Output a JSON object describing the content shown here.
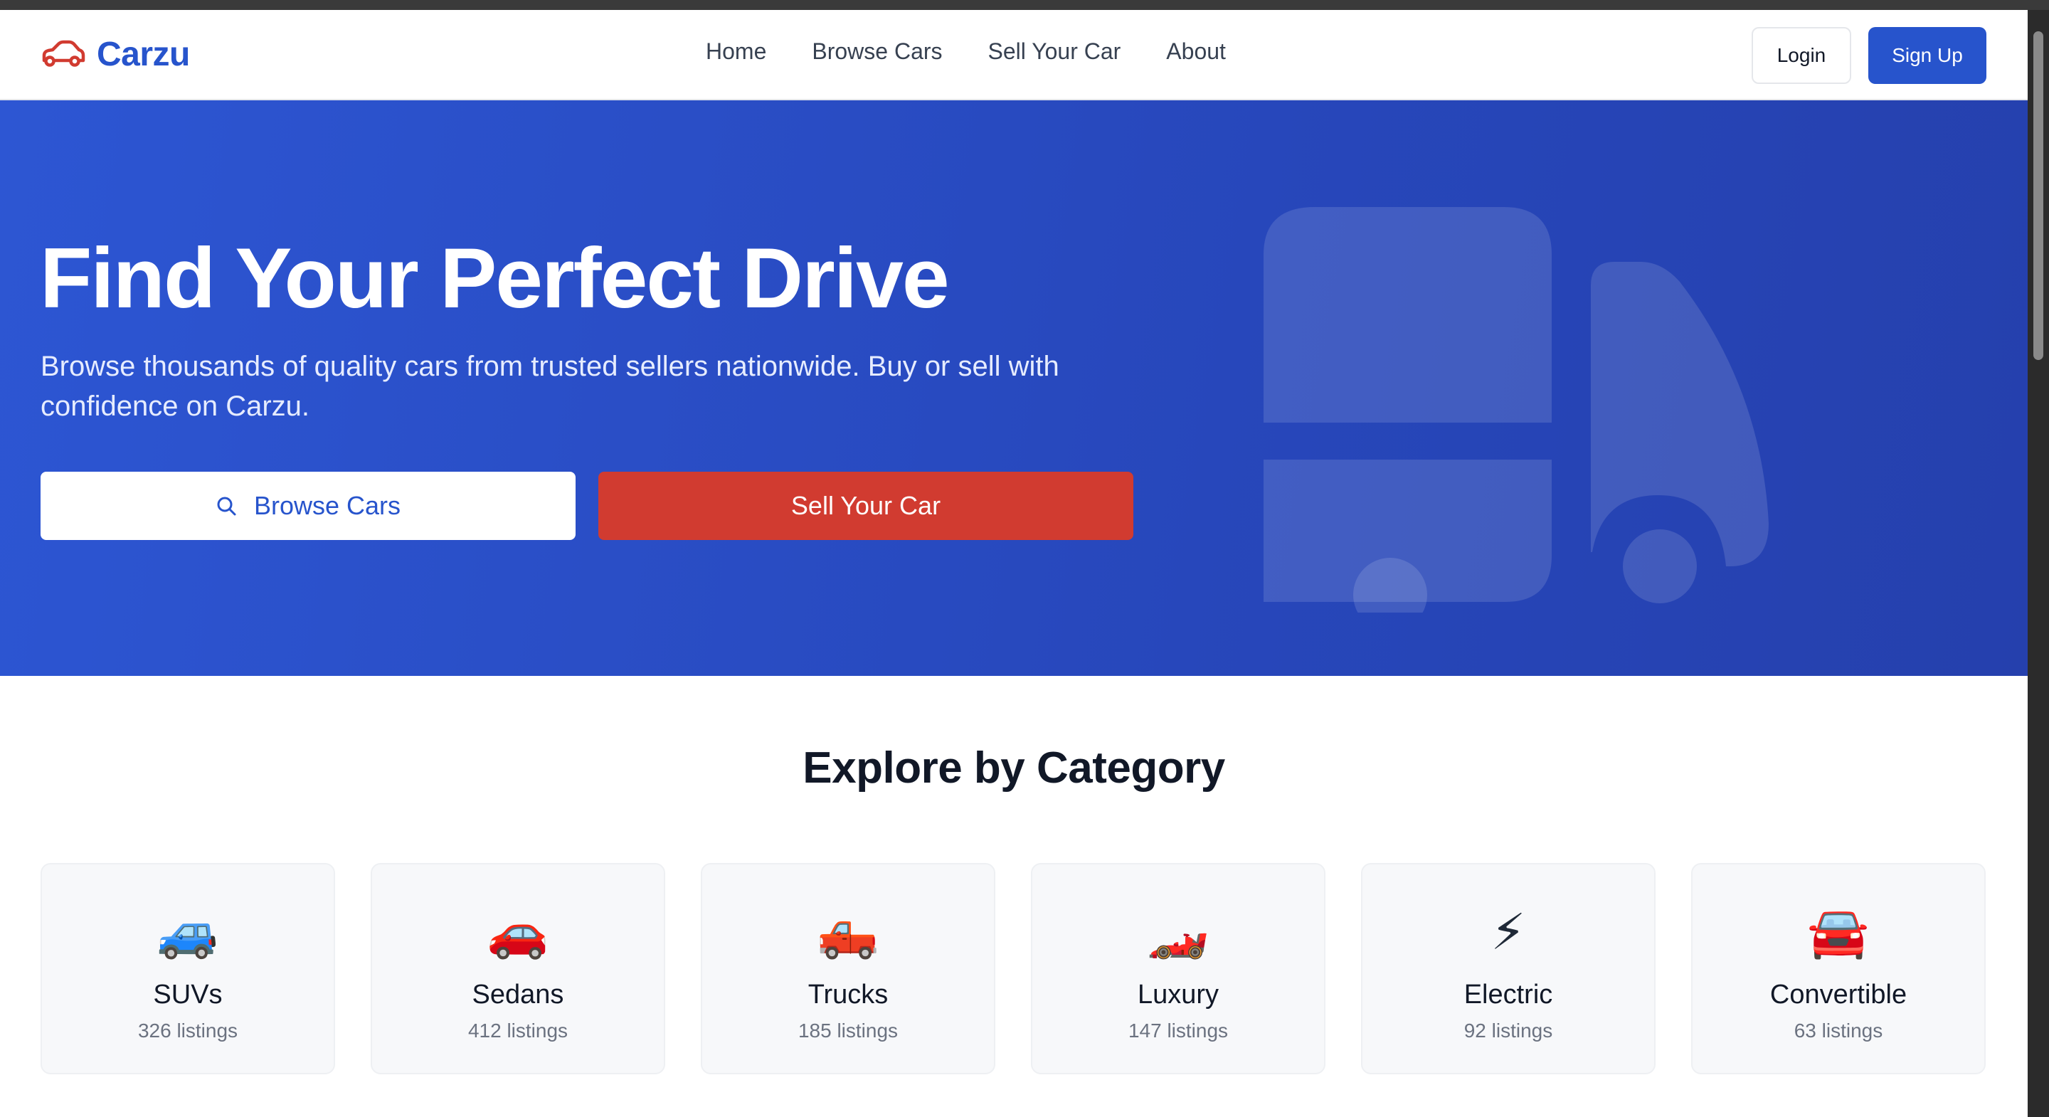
{
  "brand": {
    "name": "Carzu",
    "icon": "car-icon",
    "color": "#2754cc",
    "icon_color": "#d13b30"
  },
  "nav": {
    "links": [
      {
        "label": "Home"
      },
      {
        "label": "Browse Cars"
      },
      {
        "label": "Sell Your Car"
      },
      {
        "label": "About"
      }
    ],
    "login_label": "Login",
    "signup_label": "Sign Up"
  },
  "hero": {
    "title": "Find Your Perfect Drive",
    "subtitle": "Browse thousands of quality cars from trusted sellers nationwide. Buy or sell with confidence on Carzu.",
    "browse_label": "Browse Cars",
    "browse_icon": "search-icon",
    "sell_label": "Sell Your Car",
    "background_art": "truck-icon",
    "colors": {
      "background": "#2d56d3",
      "sell_button": "#d13b30"
    }
  },
  "categories": {
    "title": "Explore by Category",
    "items": [
      {
        "name": "SUVs",
        "count": "326 listings",
        "icon": "🚙"
      },
      {
        "name": "Sedans",
        "count": "412 listings",
        "icon": "🚗"
      },
      {
        "name": "Trucks",
        "count": "185 listings",
        "icon": "🛻"
      },
      {
        "name": "Luxury",
        "count": "147 listings",
        "icon": "🏎️"
      },
      {
        "name": "Electric",
        "count": "92 listings",
        "icon": "⚡"
      },
      {
        "name": "Convertible",
        "count": "63 listings",
        "icon": "🚘"
      }
    ]
  }
}
